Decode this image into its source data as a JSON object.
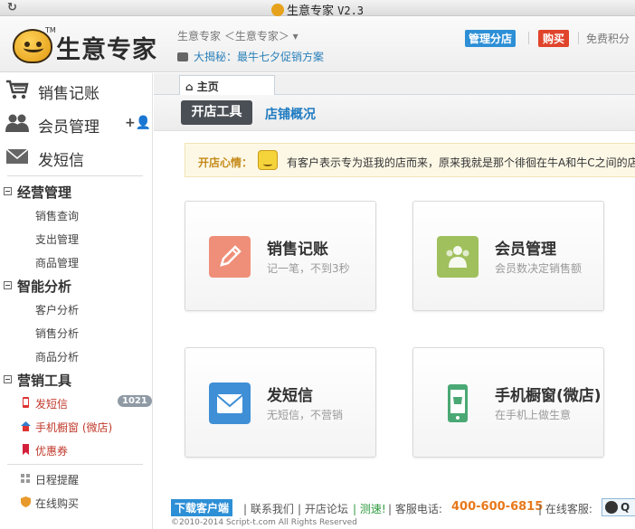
{
  "window": {
    "title": "生意专家",
    "version": "V2.3"
  },
  "header": {
    "logo_text": "生意专家",
    "logo_tm": "TM",
    "breadcrumb": "生意专家 ＜生意专家＞ ▾",
    "promo": "大揭秘：最牛七夕促销方案",
    "manage_label": "管理分店",
    "buy_label": "购买",
    "free_points": "免费积分"
  },
  "sidebar": {
    "main": [
      {
        "label": "销售记账",
        "icon": "shopping-cart-icon"
      },
      {
        "label": "会员管理",
        "icon": "members-icon",
        "action": "+👤"
      },
      {
        "label": "发短信",
        "icon": "envelope-icon"
      }
    ],
    "sections": [
      {
        "title": "经营管理",
        "items": [
          "销售查询",
          "支出管理",
          "商品管理"
        ]
      },
      {
        "title": "智能分析",
        "items": [
          "客户分析",
          "销售分析",
          "商品分析"
        ]
      },
      {
        "title": "营销工具",
        "items": [
          "发短信",
          "手机橱窗 (微店)",
          "优惠券"
        ]
      }
    ],
    "sms_badge": "1021",
    "extra": [
      "日程提醒",
      "在线购买"
    ]
  },
  "tabs": {
    "home": "主页"
  },
  "subnav": {
    "active": "开店工具",
    "other": "店铺概况"
  },
  "notice": {
    "head": "开店心情：",
    "text": "有客户表示专为逛我的店而来，原来我就是那个徘徊在牛A和牛C之间的店"
  },
  "cards": [
    {
      "title": "销售记账",
      "desc": "记一笔，不到3秒",
      "color": "#ef8f79",
      "icon": "pencil-icon"
    },
    {
      "title": "会员管理",
      "desc": "会员数决定销售额",
      "color": "#9fc05c",
      "icon": "members-icon"
    },
    {
      "title": "发短信",
      "desc": "无短信，不营销",
      "color": "#3f8fd6",
      "icon": "envelope-icon"
    },
    {
      "title": "手机橱窗(微店)",
      "desc": "在手机上做生意",
      "color": "#4aa874",
      "icon": "mobile-phone-icon"
    }
  ],
  "footer": {
    "download": "下载客户端",
    "contact": "| 联系我们",
    "forum": "| 开店论坛",
    "speed": "| 测速!",
    "tel_label": "| 客服电话:",
    "tel": "400-600-6815",
    "online": "| 在线客服:",
    "qq": "Q",
    "copyright": "©2010-2014 Script-t.com All Rights Reserved"
  }
}
